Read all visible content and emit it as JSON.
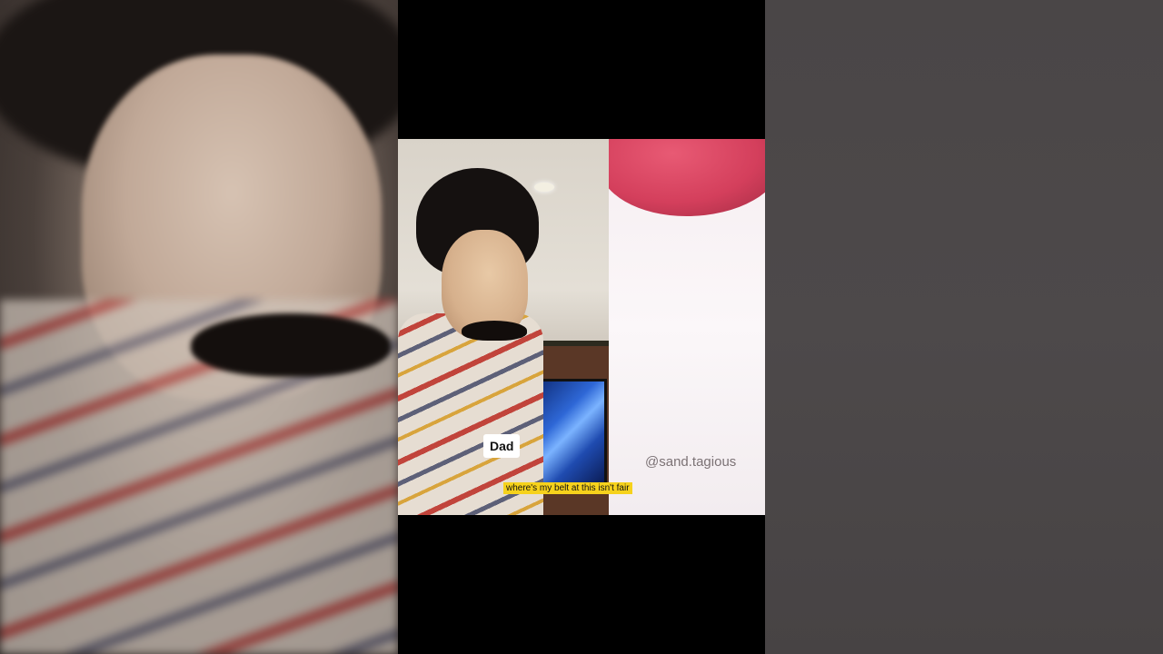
{
  "video": {
    "speaker_label": "Dad",
    "caption": "where's my belt at this isn't fair",
    "watermark": "@sand.tagious"
  },
  "colors": {
    "caption_background": "#f6d21c",
    "label_background": "#ffffff",
    "sand_color": "#d43f5c"
  }
}
